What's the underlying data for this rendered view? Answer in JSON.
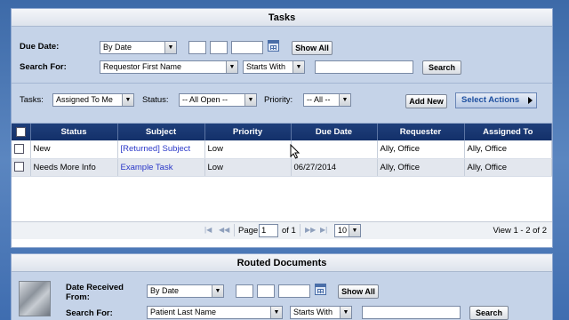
{
  "tasks": {
    "title": "Tasks",
    "due_date_label": "Due Date:",
    "due_date_mode": "By Date",
    "show_all": "Show All",
    "search_for_label": "Search For:",
    "search_field": "Requestor First Name",
    "search_match": "Starts With",
    "search_value": "",
    "search_button": "Search",
    "tasks_label": "Tasks:",
    "tasks_value": "Assigned To Me",
    "status_label": "Status:",
    "status_value": "-- All Open --",
    "priority_label": "Priority:",
    "priority_value": "-- All --",
    "add_new": "Add New",
    "select_actions": "Select Actions",
    "columns": [
      "Status",
      "Subject",
      "Priority",
      "Due Date",
      "Requester",
      "Assigned To"
    ],
    "rows": [
      {
        "status": "New",
        "subject": "[Returned] Subject",
        "priority": "Low",
        "due_date": "",
        "requester": "Ally, Office",
        "assigned_to": "Ally, Office"
      },
      {
        "status": "Needs More Info",
        "subject": "Example Task",
        "priority": "Low",
        "due_date": "06/27/2014",
        "requester": "Ally, Office",
        "assigned_to": "Ally, Office"
      }
    ],
    "pager": {
      "page_label": "Page",
      "page_value": "1",
      "of_label": "of 1",
      "page_size": "10",
      "view_text": "View 1 - 2 of 2"
    }
  },
  "routed": {
    "title": "Routed Documents",
    "date_received_label": "Date Received\nFrom:",
    "date_mode": "By Date",
    "show_all": "Show All",
    "search_for_label": "Search For:",
    "search_field": "Patient Last Name",
    "search_match": "Starts With",
    "search_button": "Search"
  },
  "icons": {
    "calendar": "calendar-icon",
    "first": "first-page-icon",
    "prev": "prev-page-icon",
    "next": "next-page-icon",
    "last": "last-page-icon"
  },
  "colors": {
    "background": "#3d6aa8",
    "filter_bg": "#c5d3e8",
    "header_bg": "#1f3f7a",
    "link": "#2a37c8",
    "select_actions_text": "#1d4fa0"
  }
}
